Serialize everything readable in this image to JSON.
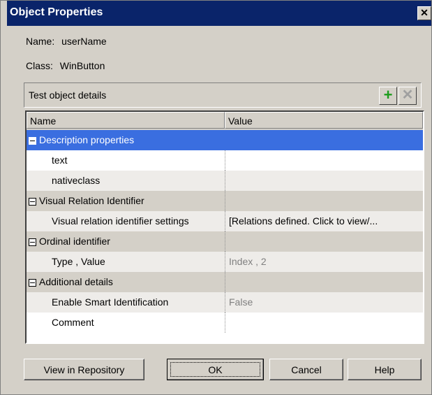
{
  "window": {
    "title": "Object Properties",
    "close_glyph": "✕"
  },
  "object": {
    "name_label": "Name:",
    "name_value": "userName",
    "class_label": "Class:",
    "class_value": "WinButton"
  },
  "details": {
    "title": "Test object details",
    "add_icon": "plus-icon",
    "delete_icon": "x-icon"
  },
  "grid": {
    "columns": [
      "Name",
      "Value"
    ],
    "rows": [
      {
        "type": "category",
        "name": "Description properties",
        "value": "",
        "selected": true
      },
      {
        "type": "item",
        "name": "text",
        "value": ""
      },
      {
        "type": "item",
        "name": "nativeclass",
        "value": ""
      },
      {
        "type": "category",
        "name": "Visual Relation Identifier",
        "value": ""
      },
      {
        "type": "item",
        "name": "Visual relation identifier settings",
        "value": "[Relations defined. Click to view/..."
      },
      {
        "type": "category",
        "name": "Ordinal identifier",
        "value": ""
      },
      {
        "type": "item",
        "name": "Type , Value",
        "value": "Index , 2"
      },
      {
        "type": "category",
        "name": "Additional details",
        "value": ""
      },
      {
        "type": "item",
        "name": "Enable Smart Identification",
        "value": "False"
      },
      {
        "type": "item",
        "name": "Comment",
        "value": ""
      }
    ]
  },
  "buttons": {
    "view_in_repository": "View in Repository",
    "ok": "OK",
    "cancel": "Cancel",
    "help": "Help"
  },
  "colors": {
    "title_bar": "#0a246a",
    "selection": "#3a6ee0",
    "add_icon": "#1c9c1c"
  }
}
